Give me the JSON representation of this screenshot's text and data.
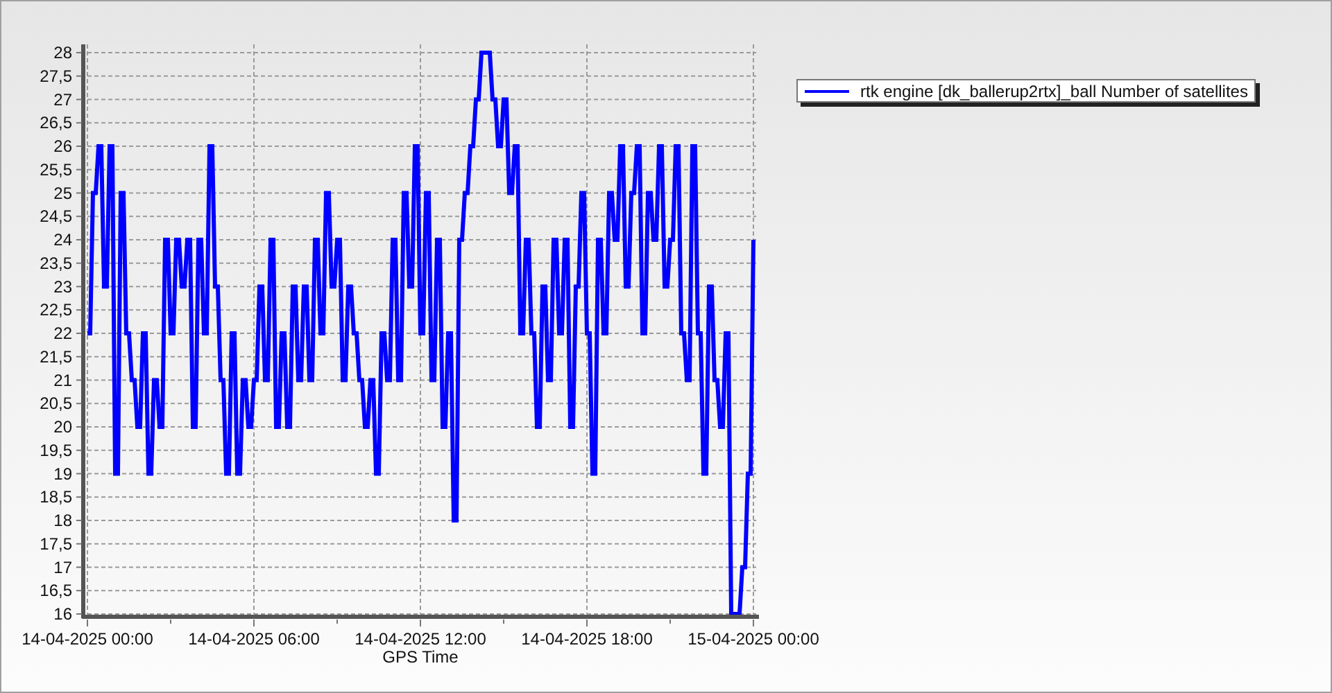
{
  "chart_data": {
    "type": "line",
    "grid": true,
    "xlabel": "GPS Time",
    "ylim": [
      16,
      28
    ],
    "yticks": [
      {
        "value": 16,
        "label": "16"
      },
      {
        "value": 16.5,
        "label": "16,5"
      },
      {
        "value": 17,
        "label": "17"
      },
      {
        "value": 17.5,
        "label": "17,5"
      },
      {
        "value": 18,
        "label": "18"
      },
      {
        "value": 18.5,
        "label": "18,5"
      },
      {
        "value": 19,
        "label": "19"
      },
      {
        "value": 19.5,
        "label": "19,5"
      },
      {
        "value": 20,
        "label": "20"
      },
      {
        "value": 20.5,
        "label": "20,5"
      },
      {
        "value": 21,
        "label": "21"
      },
      {
        "value": 21.5,
        "label": "21,5"
      },
      {
        "value": 22,
        "label": "22"
      },
      {
        "value": 22.5,
        "label": "22,5"
      },
      {
        "value": 23,
        "label": "23"
      },
      {
        "value": 23.5,
        "label": "23,5"
      },
      {
        "value": 24,
        "label": "24"
      },
      {
        "value": 24.5,
        "label": "24,5"
      },
      {
        "value": 25,
        "label": "25"
      },
      {
        "value": 25.5,
        "label": "25,5"
      },
      {
        "value": 26,
        "label": "26"
      },
      {
        "value": 26.5,
        "label": "26,5"
      },
      {
        "value": 27,
        "label": "27"
      },
      {
        "value": 27.5,
        "label": "27,5"
      },
      {
        "value": 28,
        "label": "28"
      }
    ],
    "categories": [
      "14-04-2025 00:00",
      null,
      null,
      null,
      null,
      null,
      null,
      null,
      null,
      null,
      null,
      null,
      null,
      null,
      null,
      null,
      null,
      null,
      null,
      null,
      null,
      null,
      null,
      null,
      null,
      null,
      null,
      null,
      null,
      null,
      null,
      null,
      null,
      null,
      null,
      null,
      null,
      null,
      null,
      null,
      null,
      null,
      null,
      null,
      null,
      null,
      null,
      null,
      null,
      null,
      null,
      null,
      null,
      null,
      null,
      null,
      null,
      null,
      null,
      null,
      "14-04-2025 06:00",
      null,
      null,
      null,
      null,
      null,
      null,
      null,
      null,
      null,
      null,
      null,
      null,
      null,
      null,
      null,
      null,
      null,
      null,
      null,
      null,
      null,
      null,
      null,
      null,
      null,
      null,
      null,
      null,
      null,
      null,
      null,
      null,
      null,
      null,
      null,
      null,
      null,
      null,
      null,
      null,
      null,
      null,
      null,
      null,
      null,
      null,
      null,
      null,
      null,
      null,
      null,
      null,
      null,
      null,
      null,
      null,
      null,
      null,
      null,
      "14-04-2025 12:00",
      null,
      null,
      null,
      null,
      null,
      null,
      null,
      null,
      null,
      null,
      null,
      null,
      null,
      null,
      null,
      null,
      null,
      null,
      null,
      null,
      null,
      null,
      null,
      null,
      null,
      null,
      null,
      null,
      null,
      null,
      null,
      null,
      null,
      null,
      null,
      null,
      null,
      null,
      null,
      null,
      null,
      null,
      null,
      null,
      null,
      null,
      null,
      null,
      null,
      null,
      null,
      null,
      null,
      null,
      null,
      null,
      null,
      null,
      null,
      "14-04-2025 18:00",
      null,
      null,
      null,
      null,
      null,
      null,
      null,
      null,
      null,
      null,
      null,
      null,
      null,
      null,
      null,
      null,
      null,
      null,
      null,
      null,
      null,
      null,
      null,
      null,
      null,
      null,
      null,
      null,
      null,
      null,
      null,
      null,
      null,
      null,
      null,
      null,
      null,
      null,
      null,
      null,
      null,
      null,
      null,
      null,
      null,
      null,
      null,
      null,
      null,
      null,
      null,
      null,
      null,
      null,
      null,
      null,
      null,
      null,
      null,
      "15-04-2025 00:00"
    ],
    "series": [
      {
        "name": "rtk engine [dk_ballerup2rtx]_ball Number of satellites",
        "color": "#0000ff",
        "values": [
          22,
          22,
          25,
          25,
          26,
          26,
          23,
          23,
          26,
          26,
          19,
          19,
          25,
          25,
          22,
          22,
          21,
          21,
          20,
          20,
          22,
          22,
          19,
          19,
          21,
          21,
          20,
          20,
          24,
          24,
          22,
          22,
          24,
          24,
          23,
          23,
          24,
          24,
          20,
          20,
          24,
          24,
          22,
          22,
          26,
          26,
          23,
          23,
          21,
          21,
          19,
          19,
          22,
          22,
          19,
          19,
          21,
          21,
          20,
          20,
          21,
          21,
          23,
          23,
          21,
          21,
          24,
          24,
          20,
          20,
          22,
          22,
          20,
          20,
          23,
          23,
          21,
          21,
          23,
          23,
          21,
          21,
          24,
          24,
          22,
          22,
          25,
          25,
          23,
          23,
          24,
          24,
          21,
          21,
          23,
          23,
          22,
          22,
          21,
          21,
          20,
          20,
          21,
          21,
          19,
          19,
          22,
          22,
          21,
          21,
          24,
          24,
          21,
          21,
          25,
          25,
          23,
          23,
          26,
          26,
          22,
          22,
          25,
          25,
          21,
          21,
          24,
          24,
          20,
          20,
          22,
          22,
          18,
          18,
          24,
          24,
          25,
          25,
          26,
          26,
          27,
          27,
          28,
          28,
          28,
          28,
          27,
          27,
          26,
          26,
          27,
          27,
          25,
          25,
          26,
          26,
          22,
          22,
          24,
          24,
          22,
          22,
          20,
          20,
          23,
          23,
          21,
          21,
          24,
          24,
          22,
          22,
          24,
          24,
          20,
          20,
          23,
          23,
          25,
          25,
          22,
          22,
          19,
          19,
          24,
          24,
          22,
          22,
          25,
          25,
          24,
          24,
          26,
          26,
          23,
          23,
          25,
          25,
          26,
          26,
          22,
          22,
          25,
          25,
          24,
          24,
          26,
          26,
          23,
          23,
          24,
          24,
          26,
          26,
          22,
          22,
          21,
          21,
          26,
          26,
          22,
          22,
          19,
          19,
          23,
          23,
          21,
          21,
          20,
          20,
          22,
          22,
          16,
          16,
          16,
          16,
          17,
          17,
          19,
          19,
          24
        ]
      }
    ]
  }
}
